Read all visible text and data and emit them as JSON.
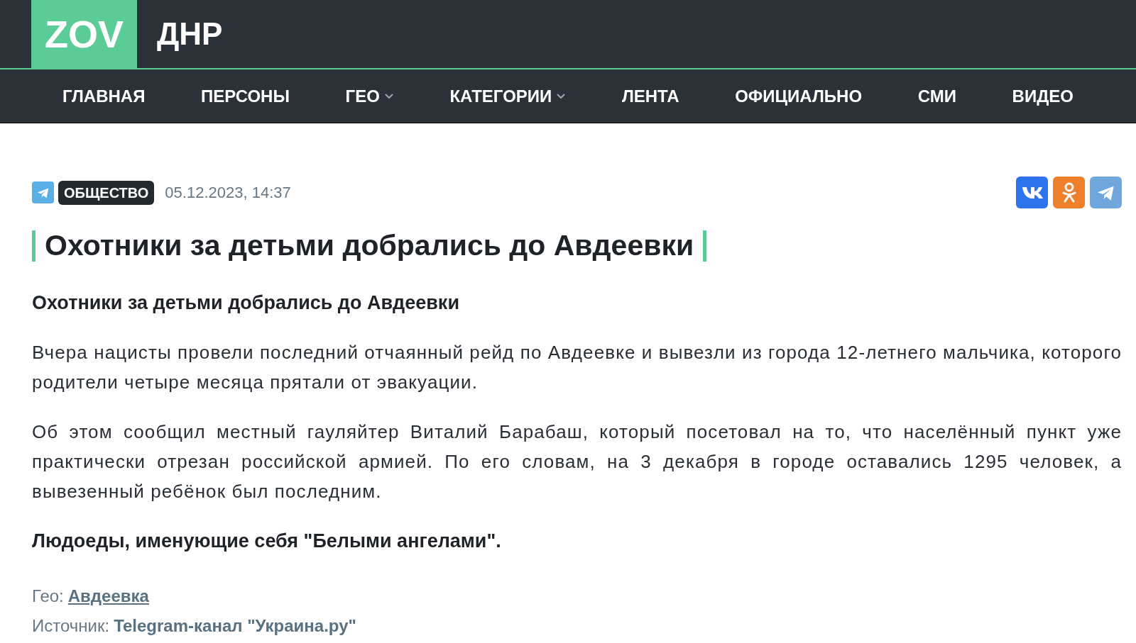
{
  "header": {
    "logo": "ZOV",
    "site_name": "ДНР"
  },
  "nav": [
    {
      "label": "ГЛАВНАЯ",
      "has_dropdown": false
    },
    {
      "label": "ПЕРСОНЫ",
      "has_dropdown": false
    },
    {
      "label": "ГЕО",
      "has_dropdown": true
    },
    {
      "label": "КАТЕГОРИИ",
      "has_dropdown": true
    },
    {
      "label": "ЛЕНТА",
      "has_dropdown": false
    },
    {
      "label": "ОФИЦИАЛЬНО",
      "has_dropdown": false
    },
    {
      "label": "СМИ",
      "has_dropdown": false
    },
    {
      "label": "ВИДЕО",
      "has_dropdown": false
    }
  ],
  "article": {
    "category": "ОБЩЕСТВО",
    "date": "05.12.2023, 14:37",
    "share": [
      {
        "kind": "vk"
      },
      {
        "kind": "ok"
      },
      {
        "kind": "telegram"
      }
    ],
    "title": "Охотники за детьми добрались до Авдеевки",
    "body": [
      {
        "kind": "bold",
        "text": "Охотники за детьми добрались до Авдеевки"
      },
      {
        "kind": "paragraph",
        "text": "Вчера нацисты провели последний отчаянный рейд по Авдеевке и вывезли из города 12-летнего мальчика, которого родители четыре месяца прятали от эвакуации."
      },
      {
        "kind": "paragraph",
        "text": "Об этом сообщил местный гауляйтер Виталий Барабаш, который посетовал на то, что населённый пункт уже практически отрезан российской армией. По его словам, на 3 декабря в городе оставались 1295 человек, а вывезенный ребёнок был последним."
      },
      {
        "kind": "bold",
        "text": "Людоеды, именующие себя \"Белыми ангелами\"."
      }
    ],
    "geo": {
      "label": "Гео:",
      "value": "Авдеевка"
    },
    "source": {
      "label": "Источник:",
      "value": "Telegram-канал \"Украина.ру\""
    }
  }
}
